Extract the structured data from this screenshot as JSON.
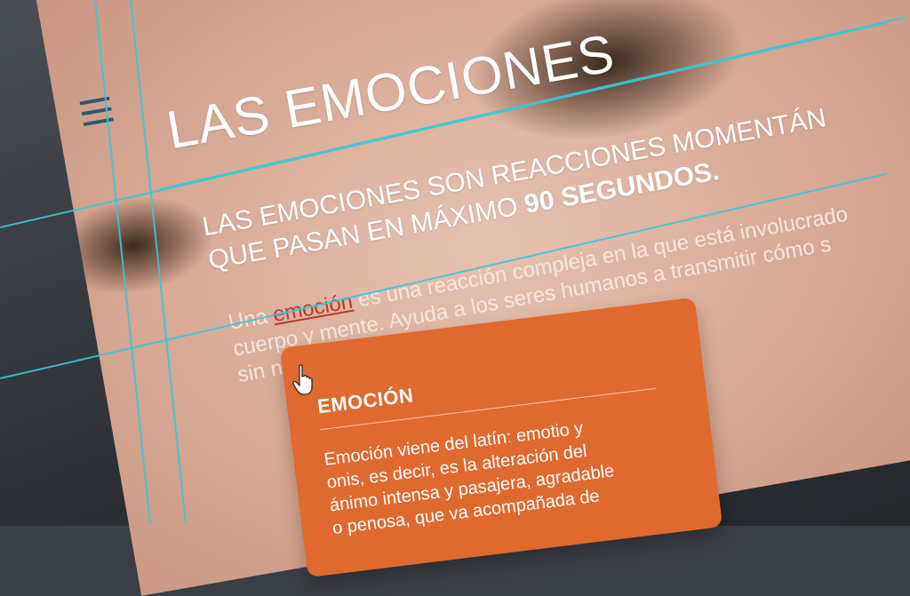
{
  "page": {
    "title": "LAS EMOCIONES",
    "subtitle_line1": "LAS EMOCIONES SON REACCIONES MOMENTÁN",
    "subtitle_line2_start": "QUE PASAN EN MÁXIMO ",
    "subtitle_line2_bold": "90 SEGUNDOS.",
    "body_line1_start": "Una ",
    "body_link": "emoción",
    "body_line1_end": " es una reacción compleja en la que está involucrado",
    "body_line2": "cuerpo y mente. Ayuda a los seres humanos a transmitir cómo s",
    "body_line3": "sin necesidad de usar palabras."
  },
  "tooltip": {
    "heading": "EMOCIÓN",
    "body_line1": "Emoción viene del latín: emotio y",
    "body_line2": "onis, es decir, es la alteración del",
    "body_line3": "ánimo intensa y pasajera, agradable",
    "body_line4": "o penosa, que va acompañada de"
  },
  "icons": {
    "menu": "hamburger-menu-icon",
    "cursor": "hand-pointer-icon"
  },
  "colors": {
    "tooltip_bg": "#e0692f",
    "link": "#c0392b",
    "guide": "#39c6d8",
    "menu_icon": "#2e5a6e"
  }
}
